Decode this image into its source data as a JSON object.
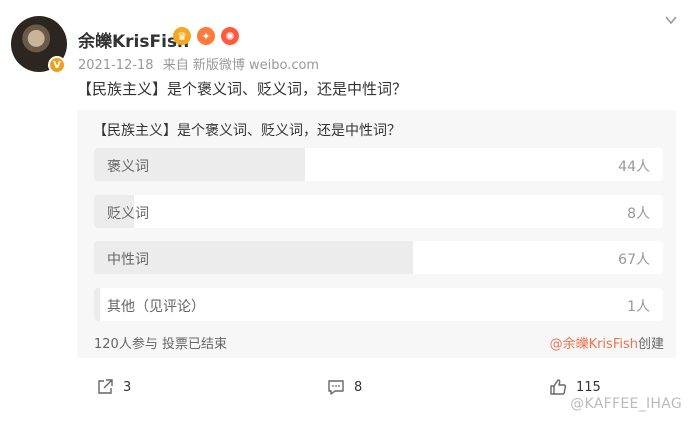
{
  "user": {
    "name": "余皪KrisFish",
    "verified_mark": "V"
  },
  "meta": {
    "date": "2021-12-18",
    "source": "来自 新版微博 weibo.com"
  },
  "post": {
    "text": "【民族主义】是个褒义词、贬义词，还是中性词？"
  },
  "poll": {
    "title": "【民族主义】是个褒义词、贬义词，还是中性词？",
    "options": [
      {
        "label": "褒义词",
        "count": "44人",
        "share": 0.37
      },
      {
        "label": "贬义词",
        "count": "8人",
        "share": 0.07
      },
      {
        "label": "中性词",
        "count": "67人",
        "share": 0.56
      },
      {
        "label": "其他（见评论）",
        "count": "1人",
        "share": 0.01
      }
    ],
    "summary": "120人参与 投票已结束",
    "creator": "@余皪KrisFish",
    "creator_suffix": "创建"
  },
  "actions": {
    "share_count": "3",
    "comment_count": "8",
    "like_count": "115"
  },
  "watermark": "@KAFFEE_IHAG",
  "colors": {
    "accent": "#eb7350",
    "poll_bg": "#f7f7f7",
    "bar_fill": "#ececec"
  }
}
